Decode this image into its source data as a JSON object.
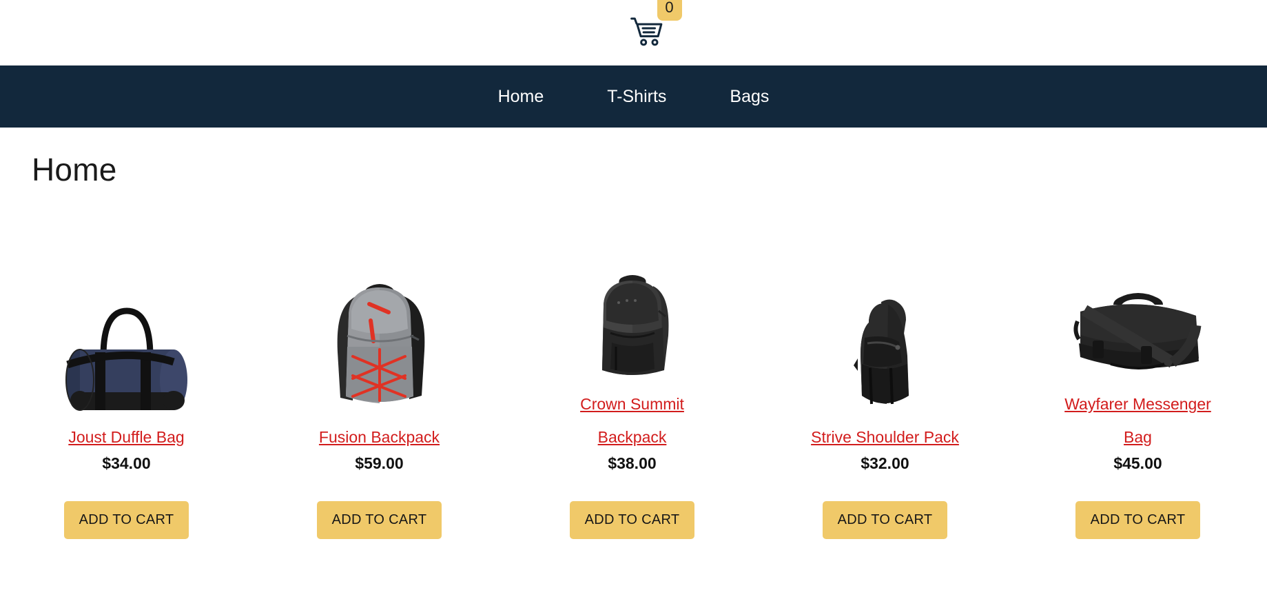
{
  "header": {
    "cart_icon": "shopping-cart-icon",
    "cart_count": "0"
  },
  "nav": {
    "items": [
      {
        "label": "Home",
        "name": "nav-item-home"
      },
      {
        "label": "T-Shirts",
        "name": "nav-item-tshirts"
      },
      {
        "label": "Bags",
        "name": "nav-item-bags"
      }
    ]
  },
  "page": {
    "title": "Home"
  },
  "colors": {
    "nav_background": "#12283c",
    "accent_gold": "#f0c969",
    "link_red": "#d21c1c",
    "page_background": "#ffffff",
    "text_dark": "#111111"
  },
  "products": [
    {
      "name": "Joust Duffle Bag",
      "price": "$34.00",
      "button_label": "ADD TO CART",
      "image": "navy-duffle-bag-image"
    },
    {
      "name": "Fusion Backpack",
      "price": "$59.00",
      "button_label": "ADD TO CART",
      "image": "gray-red-backpack-image"
    },
    {
      "name": "Crown Summit Backpack",
      "price": "$38.00",
      "button_label": "ADD TO CART",
      "image": "dark-gray-backpack-image"
    },
    {
      "name": "Strive Shoulder Pack",
      "price": "$32.00",
      "button_label": "ADD TO CART",
      "image": "black-sling-pack-image"
    },
    {
      "name": "Wayfarer Messenger Bag",
      "price": "$45.00",
      "button_label": "ADD TO CART",
      "image": "black-messenger-bag-image"
    }
  ]
}
